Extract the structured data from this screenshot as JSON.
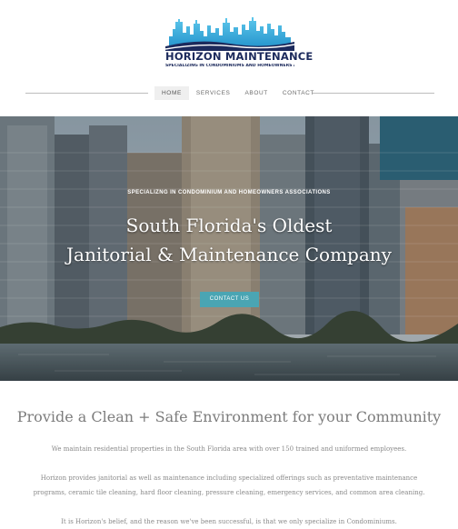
{
  "logo": {
    "title": "HORIZON MAINTENANCE",
    "tagline": "SPECIALIZING IN CONDOMINIUMS AND HOMEOWNERS ASSOCIATIONS",
    "colors": {
      "skyline": "#3fb5e0",
      "navy": "#1c2a5c"
    }
  },
  "nav": {
    "items": [
      {
        "label": "HOME",
        "active": true
      },
      {
        "label": "SERVICES",
        "active": false
      },
      {
        "label": "ABOUT",
        "active": false
      },
      {
        "label": "CONTACT",
        "active": false
      }
    ]
  },
  "hero": {
    "tagline": "SPECIALIZNG IN CONDOMINIUM AND HOMEOWNERS ASSOCIATIONS",
    "heading_line1": "South Florida's Oldest",
    "heading_line2": "Janitorial & Maintenance Company",
    "cta_label": "CONTACT US",
    "accent": "#4aa5b3"
  },
  "content": {
    "title": "Provide a Clean + Safe Environment for your Community",
    "paragraph1": "We maintain residential properties in the South Florida area with over 150 trained and uniformed employees.",
    "paragraph2_line1": "Horizon provides janitorial as well as maintenance including specialized offerings such as preventative maintenance",
    "paragraph2_line2": "programs, ceramic tile cleaning, hard floor cleaning, pressure cleaning, emergency services, and common area cleaning.",
    "paragraph3": "It is Horizon's belief, and the reason we've been successful, is that we only specialize in Condominiums."
  }
}
